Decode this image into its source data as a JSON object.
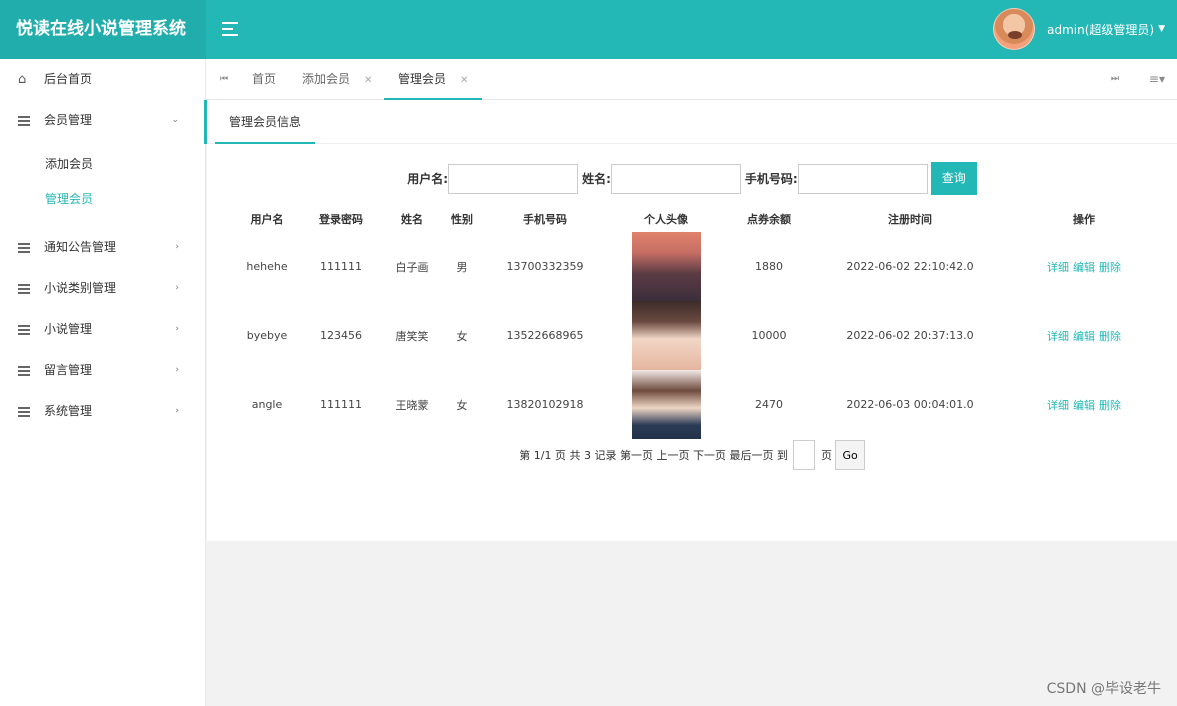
{
  "app": {
    "title": "悦读在线小说管理系统"
  },
  "user": {
    "name": "admin(超级管理员)"
  },
  "sidebar": {
    "items": [
      {
        "label": "后台首页"
      },
      {
        "label": "会员管理",
        "sub": [
          {
            "label": "添加会员"
          },
          {
            "label": "管理会员"
          }
        ]
      },
      {
        "label": "通知公告管理"
      },
      {
        "label": "小说类别管理"
      },
      {
        "label": "小说管理"
      },
      {
        "label": "留言管理"
      },
      {
        "label": "系统管理"
      }
    ]
  },
  "tabs": [
    {
      "label": "首页"
    },
    {
      "label": "添加会员"
    },
    {
      "label": "管理会员"
    }
  ],
  "content": {
    "title": "管理会员信息"
  },
  "search": {
    "username_label": "用户名:",
    "name_label": "姓名:",
    "phone_label": "手机号码:",
    "button": "查询"
  },
  "table": {
    "headers": [
      "用户名",
      "登录密码",
      "姓名",
      "性别",
      "手机号码",
      "个人头像",
      "点券余额",
      "注册时间",
      "操作"
    ],
    "rows": [
      {
        "username": "hehehe",
        "password": "111111",
        "name": "白子画",
        "gender": "男",
        "phone": "13700332359",
        "balance": "1880",
        "time": "2022-06-02 22:10:42.0"
      },
      {
        "username": "byebye",
        "password": "123456",
        "name": "唐笑笑",
        "gender": "女",
        "phone": "13522668965",
        "balance": "10000",
        "time": "2022-06-02 20:37:13.0"
      },
      {
        "username": "angle",
        "password": "111111",
        "name": "王晓蒙",
        "gender": "女",
        "phone": "13820102918",
        "balance": "2470",
        "time": "2022-06-03 00:04:01.0"
      }
    ],
    "ops": {
      "detail": "详细",
      "edit": "编辑",
      "delete": "删除"
    }
  },
  "pager": {
    "text": "第 1/1 页 共 3 记录 第一页 上一页 下一页 最后一页 到",
    "page_unit": "页",
    "go": "Go"
  },
  "watermark": "CSDN @毕设老牛",
  "colors": {
    "accent": "#23b7b6"
  }
}
